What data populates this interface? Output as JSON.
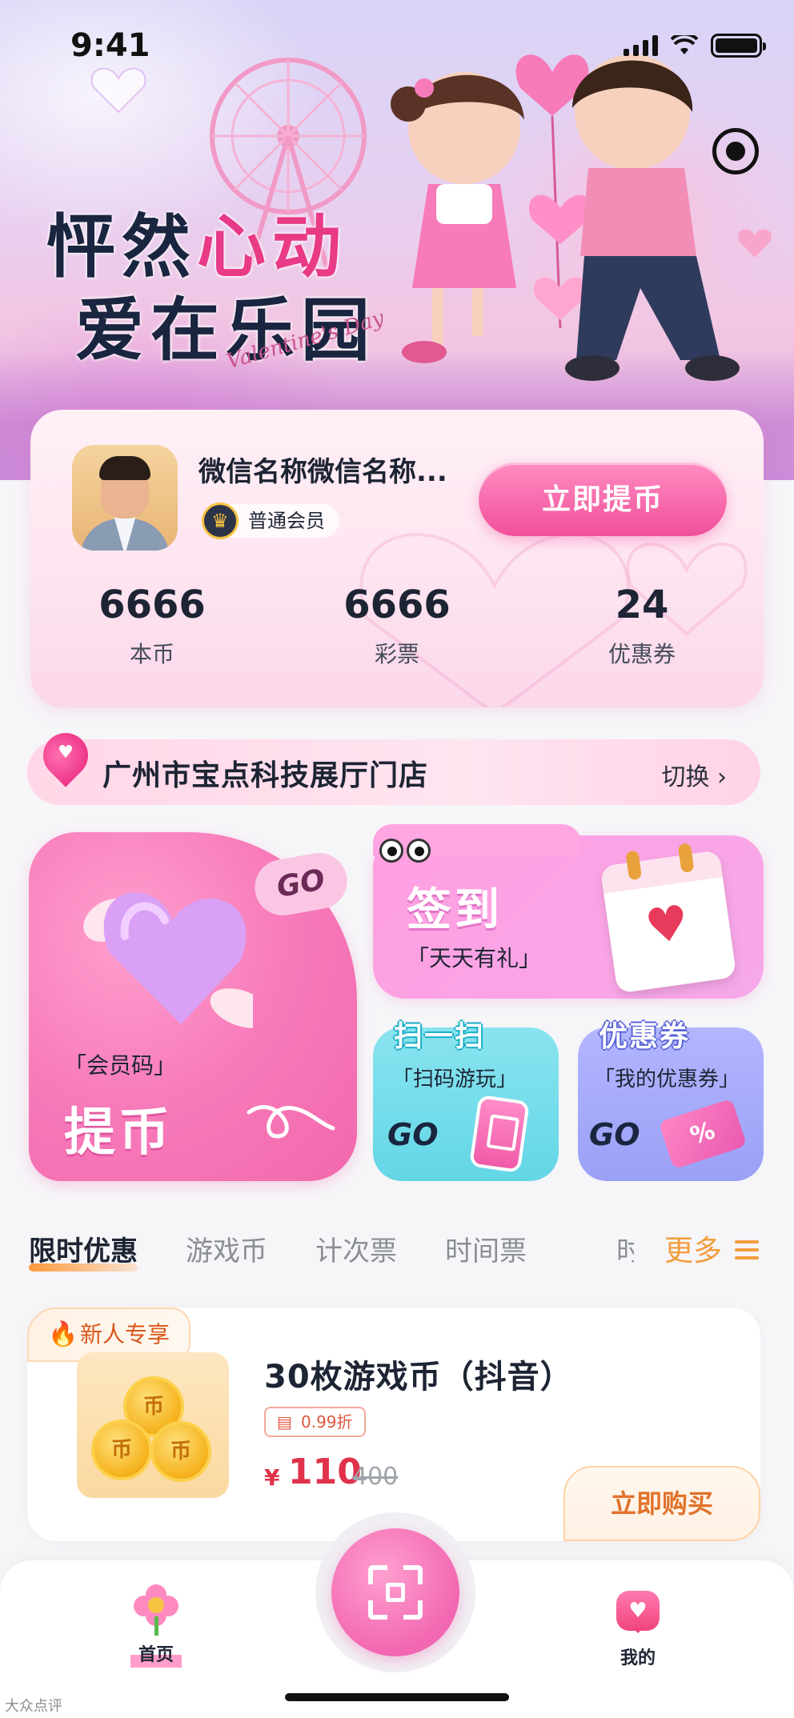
{
  "status_bar": {
    "time": "9:41"
  },
  "hero": {
    "title_part1": "怦然",
    "title_part1_accent": "心动",
    "title_line2": "爱在乐园",
    "script_text": "Valentine's Day"
  },
  "user": {
    "nickname": "微信名称微信名称...",
    "member_level": "普通会员",
    "withdraw_label": "立即提币",
    "stats": [
      {
        "value": "6666",
        "label": "本币"
      },
      {
        "value": "6666",
        "label": "彩票"
      },
      {
        "value": "24",
        "label": "优惠券"
      }
    ]
  },
  "store": {
    "name": "广州市宝点科技展厅门店",
    "switch_label": "切换",
    "switch_chevron": "›"
  },
  "actions": {
    "member_code": {
      "go": "GO",
      "label": "「会员码」",
      "title": "提币"
    },
    "sign_in": {
      "title": "签到",
      "subtitle": "「天天有礼」"
    },
    "scan": {
      "title": "扫一扫",
      "subtitle": "「扫码游玩」",
      "go": "GO"
    },
    "coupon": {
      "title": "优惠券",
      "subtitle": "「我的优惠券」",
      "go": "GO",
      "ticket_symbol": "%"
    }
  },
  "tabs": {
    "items": [
      "限时优惠",
      "游戏币",
      "计次票",
      "时间票"
    ],
    "cut_item": "时",
    "active_index": 0,
    "more_label": "更多"
  },
  "product": {
    "badge": "新人专享",
    "title": "30枚游戏币（抖音）",
    "discount": "0.99折",
    "currency": "¥",
    "price": "110",
    "original_price": "400",
    "buy_label": "立即购买",
    "coin_text": "币"
  },
  "bottom_nav": {
    "home_label": "首页",
    "mine_label": "我的"
  },
  "watermark": "大众点评",
  "icons": {
    "record": "record-icon",
    "pin": "location-pin-icon",
    "crown": "crown-icon",
    "fire": "fire-icon",
    "scan": "qr-scan-icon"
  },
  "colors": {
    "accent_pink": "#f0509a",
    "accent_orange": "#f39c3c",
    "price_red": "#e0324a"
  }
}
